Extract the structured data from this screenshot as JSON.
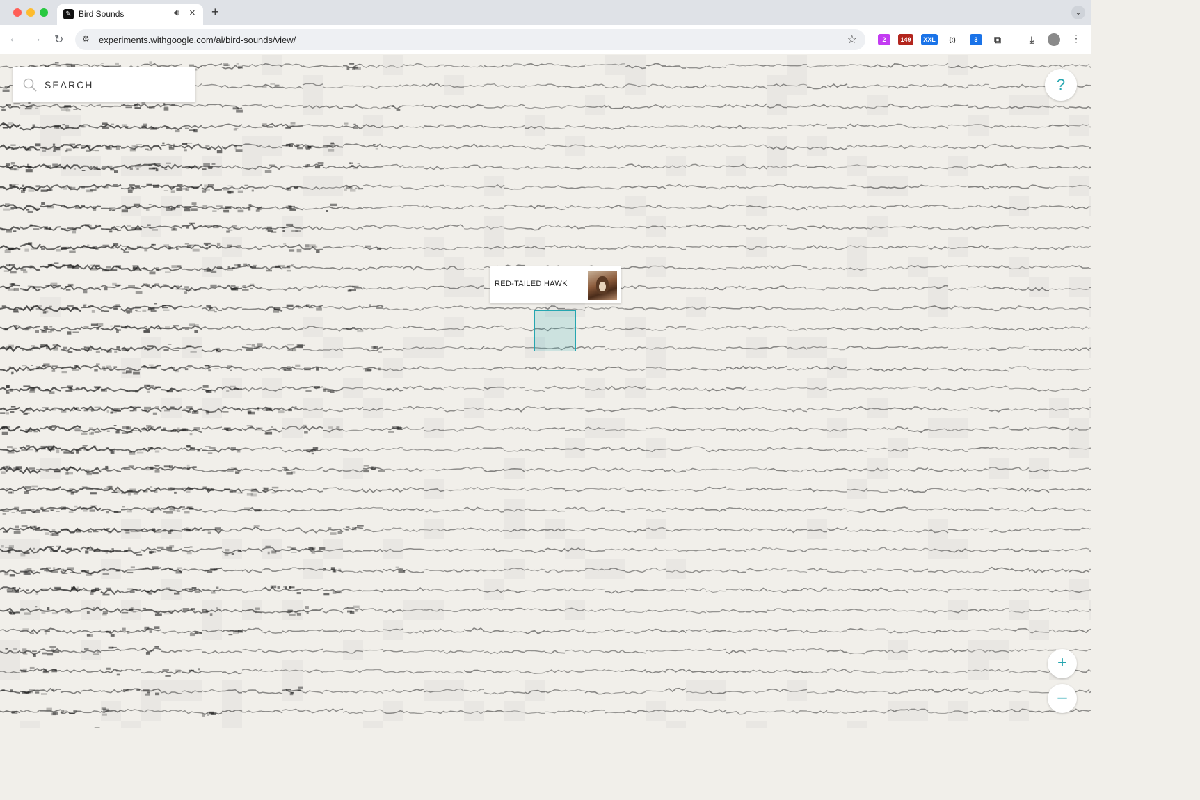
{
  "browser": {
    "tab": {
      "title": "Bird Sounds",
      "favicon": "bird-favicon",
      "audio_icon": "speaker-icon"
    },
    "url": "experiments.withgoogle.com/ai/bird-sounds/view/",
    "extensions": [
      {
        "name": "extension-icon",
        "badge": "2"
      },
      {
        "name": "extension-icon",
        "badge": "149"
      },
      {
        "name": "extension-icon",
        "badge": "XXL"
      },
      {
        "name": "extension-icon",
        "badge": "{:}"
      },
      {
        "name": "extension-icon",
        "badge": "3"
      }
    ]
  },
  "page": {
    "search": {
      "placeholder": "SEARCH"
    },
    "help": {
      "label": "?"
    },
    "tooltip": {
      "label": "RED-TAILED HAWK"
    },
    "zoom": {
      "in_label": "+",
      "out_label": "–"
    },
    "colors": {
      "accent": "#26a6b0",
      "background": "#f1efea"
    }
  }
}
